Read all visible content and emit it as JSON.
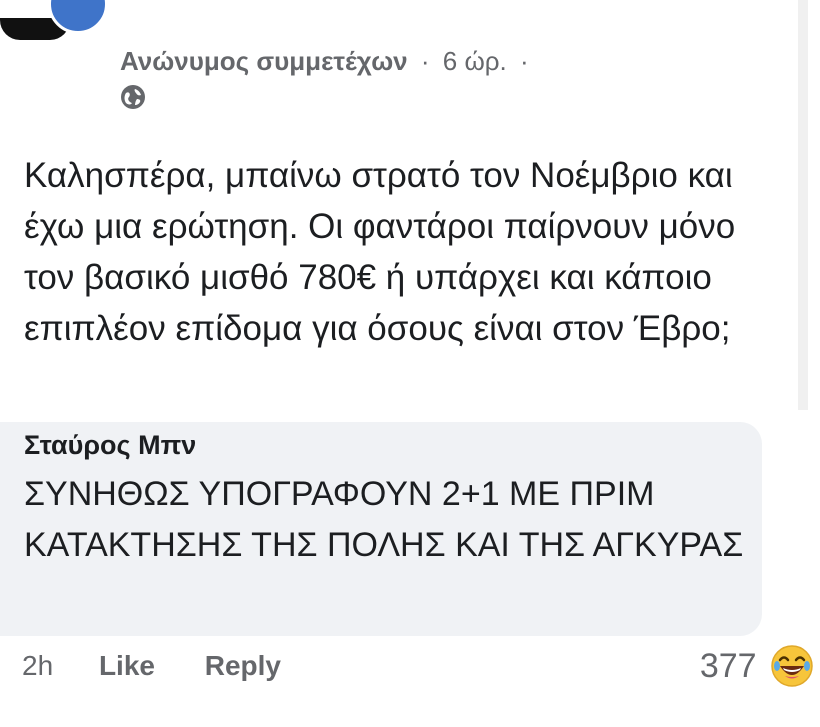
{
  "post": {
    "author": "Ανώνυμος συμμετέχων",
    "separator": "·",
    "time": "6 ώρ.",
    "trailing_dot": "·",
    "privacy_icon": "globe-icon",
    "text": "Καλησπέρα, μπαίνω στρατό τον Νοέμβριο και έχω μια ερώτηση. Οι φαντάροι παίρνουν μόνο τον βασικό μισθό 780€ ή υπάρχει και κάποιο επιπλέον επίδομα για όσους είναι στον Έβρο;"
  },
  "comment": {
    "author": "Σταύρος Μπν",
    "text": "ΣΥΝΗΘΩΣ ΥΠΟΓΡΑΦΟΥΝ 2+1 ΜΕ ΠΡΙΜ ΚΑΤΑΚΤΗΣΗΣ ΤΗΣ ΠΟΛΗΣ ΚΑΙ ΤΗΣ ΑΓΚΥΡΑΣ",
    "time": "2h",
    "like_label": "Like",
    "reply_label": "Reply",
    "reaction_count": "377",
    "reaction_icon": "laughing-emoji-icon"
  },
  "colors": {
    "meta_gray": "#65676b",
    "bubble_bg": "#f0f2f5",
    "avatar_blue": "#3f74c9",
    "emoji_yellow": "#f7c53b"
  }
}
